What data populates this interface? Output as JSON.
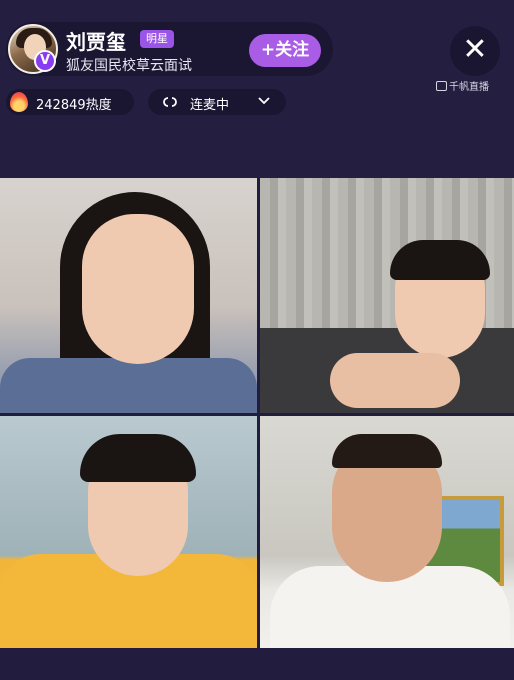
{
  "host": {
    "name": "刘贾玺",
    "badge": "明星",
    "verified_badge": "V",
    "subtitle": "狐友国民校草云面试",
    "follow_label": "+关注"
  },
  "controls": {
    "close_label": "✕",
    "watermark": "千帆直播"
  },
  "stats": {
    "heat": "242849热度",
    "link_status": "连麦中"
  },
  "tiles": [
    {
      "name": "guest-female"
    },
    {
      "name": "guest-heart-hands"
    },
    {
      "name": "guest-yellow-shirt"
    },
    {
      "name": "guest-peace-sign"
    }
  ],
  "colors": {
    "background": "#221d3f",
    "follow_button": "#a95de6",
    "star_badge": "#9b54e8"
  }
}
